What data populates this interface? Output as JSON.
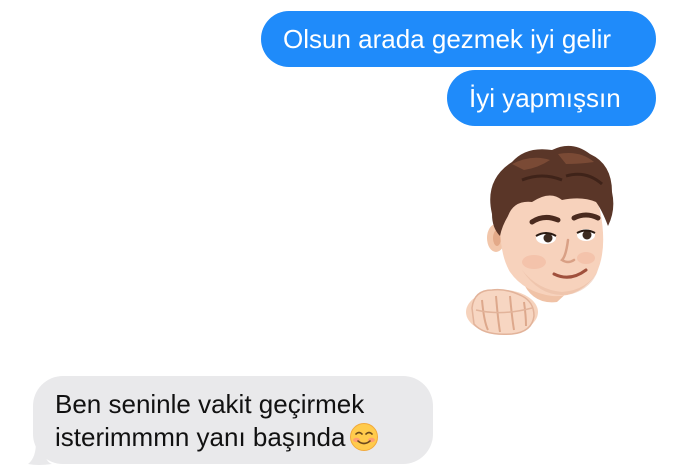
{
  "conversation": {
    "sent_messages": [
      {
        "text": "Olsun arada gezmek iyi gelir"
      },
      {
        "text": "İyi yapmışsın"
      }
    ],
    "sticker": {
      "icon": "memoji-punch-sticker"
    },
    "received_messages": [
      {
        "text": "Ben seninle vakit geçirmek isterimmmn yanı başında",
        "emoji": "smiling-face-icon"
      }
    ]
  },
  "colors": {
    "sent_bubble": "#1f8bfa",
    "received_bubble": "#e9e9eb",
    "background": "#ffffff"
  }
}
